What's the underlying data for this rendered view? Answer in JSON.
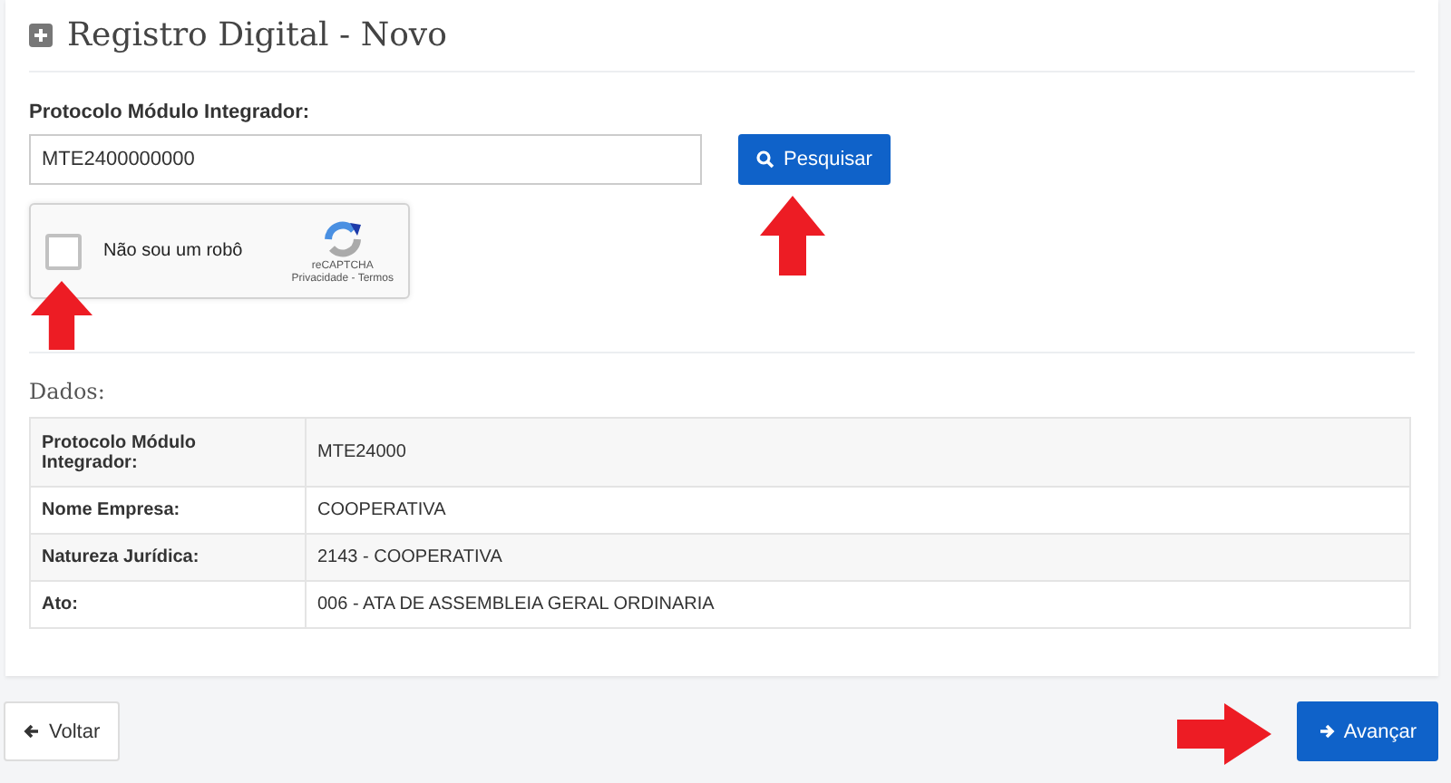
{
  "panel": {
    "title": "Registro Digital - Novo"
  },
  "search": {
    "label": "Protocolo Módulo Integrador:",
    "value": "MTE2400000000",
    "button": "Pesquisar"
  },
  "captcha": {
    "label": "Não sou um robô",
    "checked": false,
    "brand": "reCAPTCHA",
    "links": "Privacidade - Termos"
  },
  "data": {
    "heading": "Dados:",
    "rows": [
      {
        "label": "Protocolo Módulo Integrador:",
        "value": "MTE24000"
      },
      {
        "label": "Nome Empresa:",
        "value": "COOPERATIVA"
      },
      {
        "label": "Natureza Jurídica:",
        "value": "2143 - COOPERATIVA"
      },
      {
        "label": "Ato:",
        "value": "006 - ATA DE ASSEMBLEIA GERAL ORDINARIA"
      }
    ]
  },
  "footer": {
    "back": "Voltar",
    "next": "Avançar"
  }
}
